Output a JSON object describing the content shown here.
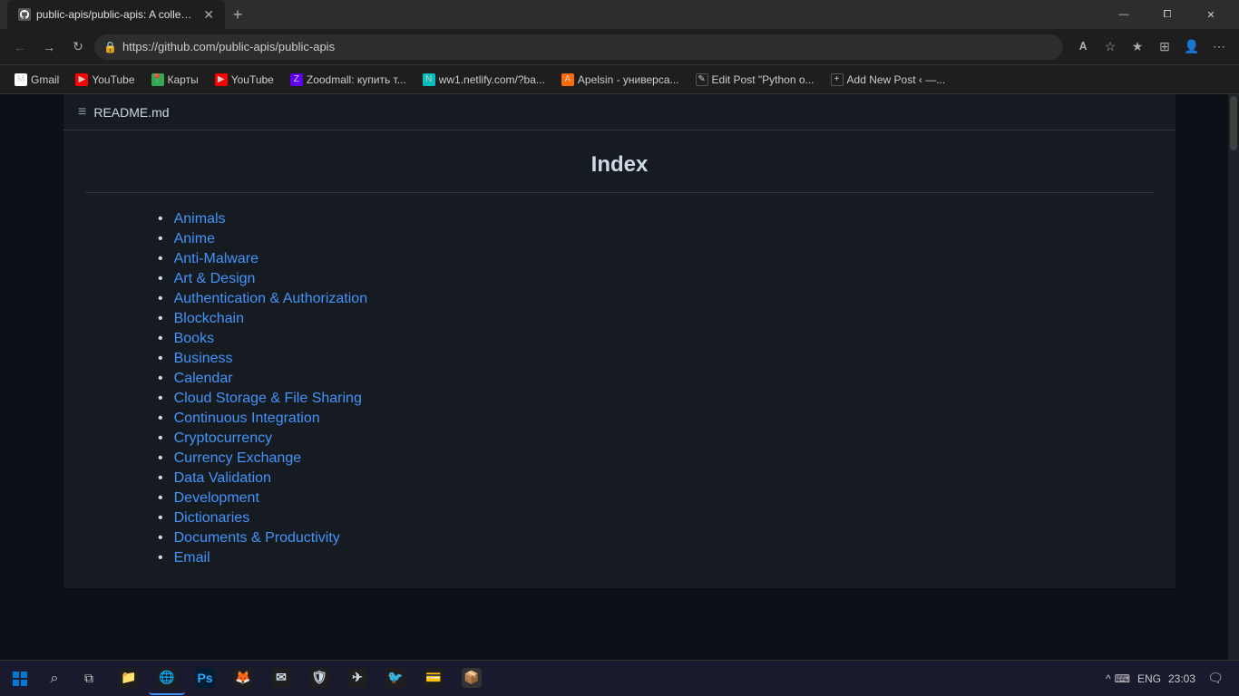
{
  "browser": {
    "tab": {
      "title": "public-apis/public-apis: A collec...",
      "favicon": "github"
    },
    "address": "https://github.com/public-apis/public-apis",
    "nav": {
      "back": "←",
      "forward": "→",
      "refresh": "↺",
      "home": "⌂"
    }
  },
  "bookmarks": [
    {
      "id": "gmail",
      "label": "Gmail",
      "icon": "M",
      "iconClass": "bm-gmail"
    },
    {
      "id": "youtube1",
      "label": "YouTube",
      "icon": "▶",
      "iconClass": "bm-youtube"
    },
    {
      "id": "maps",
      "label": "Карты",
      "icon": "📍",
      "iconClass": "bm-maps"
    },
    {
      "id": "youtube2",
      "label": "YouTube",
      "icon": "▶",
      "iconClass": "bm-youtube"
    },
    {
      "id": "zoodmall",
      "label": "Zoodmall: купить т...",
      "icon": "Z",
      "iconClass": "bm-zoodmall"
    },
    {
      "id": "netlify",
      "label": "ww1.netlify.com/?ba...",
      "icon": "N",
      "iconClass": "bm-netlify"
    },
    {
      "id": "apelsin",
      "label": "Apelsin - универса...",
      "icon": "A",
      "iconClass": "bm-apelsin"
    },
    {
      "id": "editpost",
      "label": "Edit Post \"Python o...",
      "icon": "✎",
      "iconClass": "bm-editpost"
    },
    {
      "id": "addnew",
      "label": "Add New Post ‹ —...",
      "icon": "+",
      "iconClass": "bm-addnew"
    }
  ],
  "readme": {
    "icon": "≡",
    "filename": "README.md"
  },
  "index": {
    "title": "Index",
    "links": [
      "Animals",
      "Anime",
      "Anti-Malware",
      "Art & Design",
      "Authentication & Authorization",
      "Blockchain",
      "Books",
      "Business",
      "Calendar",
      "Cloud Storage & File Sharing",
      "Continuous Integration",
      "Cryptocurrency",
      "Currency Exchange",
      "Data Validation",
      "Development",
      "Dictionaries",
      "Documents & Productivity",
      "Email"
    ]
  },
  "taskbar": {
    "time": "23:03",
    "date": "",
    "lang": "ENG",
    "apps": [
      {
        "id": "start",
        "type": "start"
      },
      {
        "id": "search",
        "type": "search",
        "icon": "🔍"
      },
      {
        "id": "taskview",
        "type": "taskview",
        "icon": "⧉"
      },
      {
        "id": "file-explorer",
        "icon": "📁",
        "color": "#ffd700"
      },
      {
        "id": "chrome",
        "icon": "🌐",
        "color": "#4285f4",
        "active": true
      },
      {
        "id": "photoshop",
        "icon": "Ps",
        "color": "#001d34"
      },
      {
        "id": "browser2",
        "icon": "🦊",
        "color": "#ff6d00"
      },
      {
        "id": "mail",
        "icon": "✉",
        "color": "#0078d4"
      },
      {
        "id": "app1",
        "icon": "🛡",
        "color": "#2d2d2d"
      },
      {
        "id": "telegram",
        "icon": "✈",
        "color": "#2ca5e0"
      },
      {
        "id": "twitter",
        "icon": "🐦",
        "color": "#1da1f2"
      },
      {
        "id": "app2",
        "icon": "💳",
        "color": "#ff6b00"
      },
      {
        "id": "app3",
        "icon": "📦",
        "color": "#333"
      }
    ],
    "sys": {
      "chevron": "^",
      "keyboard": "⌨",
      "lang": "ENG",
      "time": "23:03",
      "notification": "🔔"
    }
  },
  "window_controls": {
    "minimize": "—",
    "maximize": "⧠",
    "close": "✕"
  }
}
